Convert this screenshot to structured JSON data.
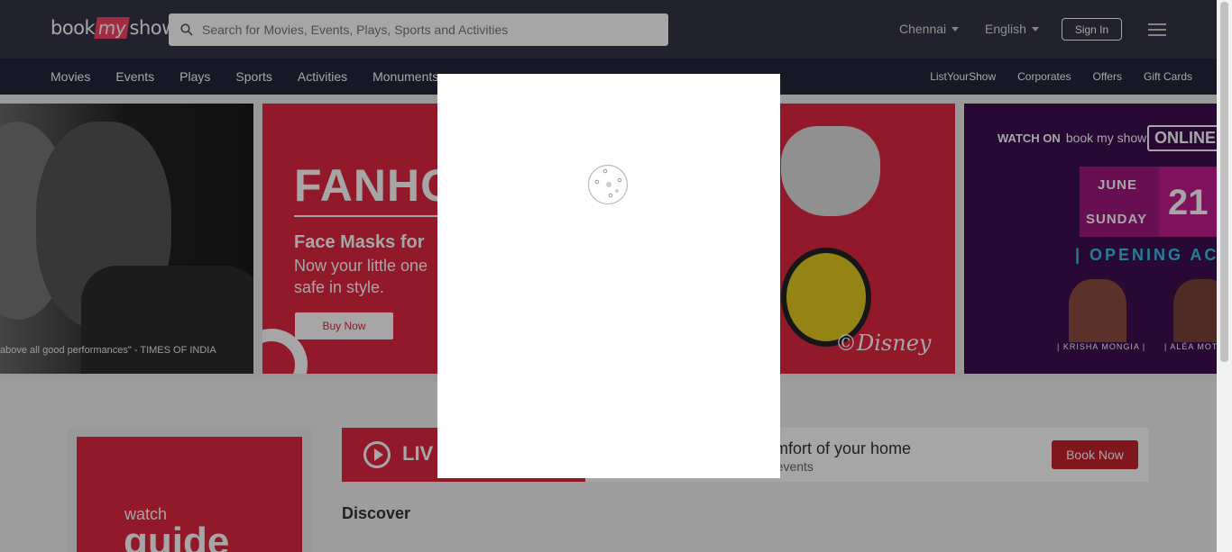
{
  "header": {
    "logo": {
      "part1": "book",
      "part2": "my",
      "part3": "show"
    },
    "search_placeholder": "Search for Movies, Events, Plays, Sports and Activities",
    "city": "Chennai",
    "language": "English",
    "signin_label": "Sign In"
  },
  "nav": {
    "left": [
      "Movies",
      "Events",
      "Plays",
      "Sports",
      "Activities",
      "Monuments"
    ],
    "right": [
      "ListYourShow",
      "Corporates",
      "Offers",
      "Gift Cards"
    ]
  },
  "banners": {
    "b1_quote": "above all good performances\" - TIMES OF INDIA",
    "b2": {
      "title": "FANHO",
      "heading": "Face Masks for",
      "subheading": "Now your little one safe in style.",
      "button": "Buy Now",
      "brand": "©Disney"
    },
    "b3": {
      "watch_on": "WATCH ON",
      "bms": "book my show",
      "online": "ONLINE",
      "month": "JUNE",
      "day": "SUNDAY",
      "date": "21",
      "opening": "| OPENING ACT",
      "name1": "| KRISHA MONGIA |",
      "name2": "| ALÉA MOTV"
    }
  },
  "lower": {
    "watch_label": "watch",
    "guide_label": "guide",
    "live_label": "LIV",
    "comfort": "omfort of your home",
    "comfort_sub": "g events",
    "book_now": "Book Now",
    "discover": "Discover"
  },
  "colors": {
    "header_bg": "#333545",
    "nav_bg": "#222539",
    "brand_red": "#e0273f",
    "accent_pink": "#f84464"
  },
  "icons": [
    "search-icon",
    "caret-down-icon",
    "hamburger-menu-icon",
    "play-icon",
    "loading-spinner-icon"
  ]
}
